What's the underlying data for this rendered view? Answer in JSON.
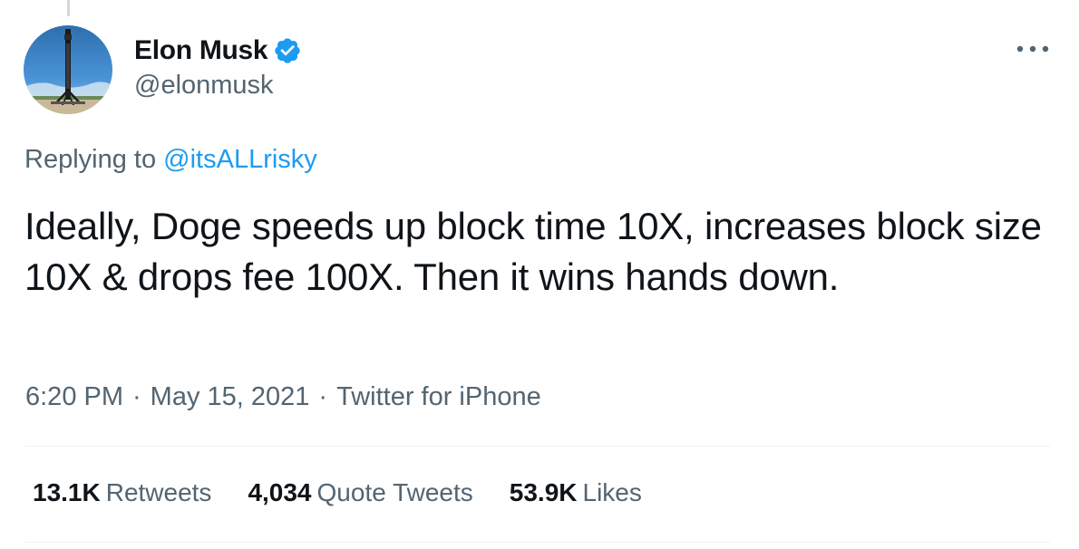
{
  "author": {
    "name": "Elon Musk",
    "handle": "@elonmusk",
    "verified": true
  },
  "reply": {
    "prefix": "Replying to",
    "mention": "@itsALLrisky"
  },
  "tweet": {
    "text": "Ideally, Doge speeds up block time 10X, increases block size 10X & drops fee 100X. Then it wins hands down.",
    "time": "6:20 PM",
    "date": "May 15, 2021",
    "source": "Twitter for iPhone",
    "separator": "·"
  },
  "stats": [
    {
      "count": "13.1K",
      "label": "Retweets"
    },
    {
      "count": "4,034",
      "label": "Quote Tweets"
    },
    {
      "count": "53.9K",
      "label": "Likes"
    }
  ],
  "colors": {
    "text_primary": "#0f1419",
    "text_secondary": "#536471",
    "link": "#1d9bf0",
    "verified_badge": "#1d9bf0",
    "divider": "#eff3f4"
  },
  "icons": {
    "verified": "verified-badge-icon",
    "more": "more-options-icon"
  }
}
